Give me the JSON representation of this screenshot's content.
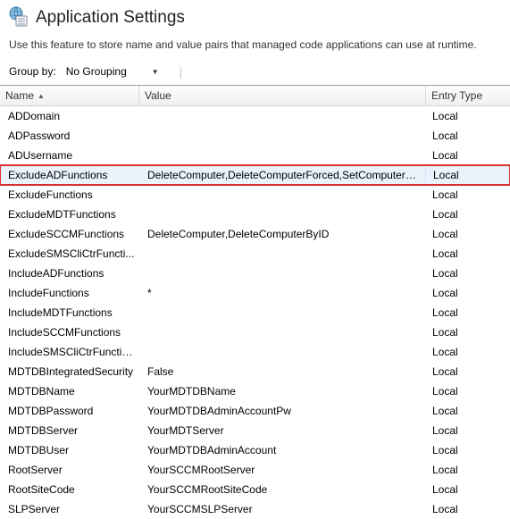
{
  "header": {
    "title": "Application Settings",
    "description": "Use this feature to store name and value pairs that managed code applications can use at runtime."
  },
  "groupbar": {
    "label": "Group by:",
    "selected": "No Grouping"
  },
  "columns": {
    "name": "Name",
    "value": "Value",
    "entry": "Entry Type"
  },
  "rows": [
    {
      "name": "ADDomain",
      "value": "",
      "entry": "Local",
      "highlight": false
    },
    {
      "name": "ADPassword",
      "value": "",
      "entry": "Local",
      "highlight": false
    },
    {
      "name": "ADUsername",
      "value": "",
      "entry": "Local",
      "highlight": false
    },
    {
      "name": "ExcludeADFunctions",
      "value": "DeleteComputer,DeleteComputerForced,SetComputerA...",
      "entry": "Local",
      "highlight": true
    },
    {
      "name": "ExcludeFunctions",
      "value": "",
      "entry": "Local",
      "highlight": false
    },
    {
      "name": "ExcludeMDTFunctions",
      "value": "",
      "entry": "Local",
      "highlight": false
    },
    {
      "name": "ExcludeSCCMFunctions",
      "value": "DeleteComputer,DeleteComputerByID",
      "entry": "Local",
      "highlight": false
    },
    {
      "name": "ExcludeSMSCliCtrFuncti...",
      "value": "",
      "entry": "Local",
      "highlight": false
    },
    {
      "name": "IncludeADFunctions",
      "value": "",
      "entry": "Local",
      "highlight": false
    },
    {
      "name": "IncludeFunctions",
      "value": "*",
      "entry": "Local",
      "highlight": false
    },
    {
      "name": "IncludeMDTFunctions",
      "value": "",
      "entry": "Local",
      "highlight": false
    },
    {
      "name": "IncludeSCCMFunctions",
      "value": "",
      "entry": "Local",
      "highlight": false
    },
    {
      "name": "IncludeSMSCliCtrFunctio...",
      "value": "",
      "entry": "Local",
      "highlight": false
    },
    {
      "name": "MDTDBIntegratedSecurity",
      "value": "False",
      "entry": "Local",
      "highlight": false
    },
    {
      "name": "MDTDBName",
      "value": "YourMDTDBName",
      "entry": "Local",
      "highlight": false
    },
    {
      "name": "MDTDBPassword",
      "value": "YourMDTDBAdminAccountPw",
      "entry": "Local",
      "highlight": false
    },
    {
      "name": "MDTDBServer",
      "value": "YourMDTServer",
      "entry": "Local",
      "highlight": false
    },
    {
      "name": "MDTDBUser",
      "value": "YourMDTDBAdminAccount",
      "entry": "Local",
      "highlight": false
    },
    {
      "name": "RootServer",
      "value": "YourSCCMRootServer",
      "entry": "Local",
      "highlight": false
    },
    {
      "name": "RootSiteCode",
      "value": "YourSCCMRootSiteCode",
      "entry": "Local",
      "highlight": false
    },
    {
      "name": "SLPServer",
      "value": "YourSCCMSLPServer",
      "entry": "Local",
      "highlight": false
    }
  ]
}
